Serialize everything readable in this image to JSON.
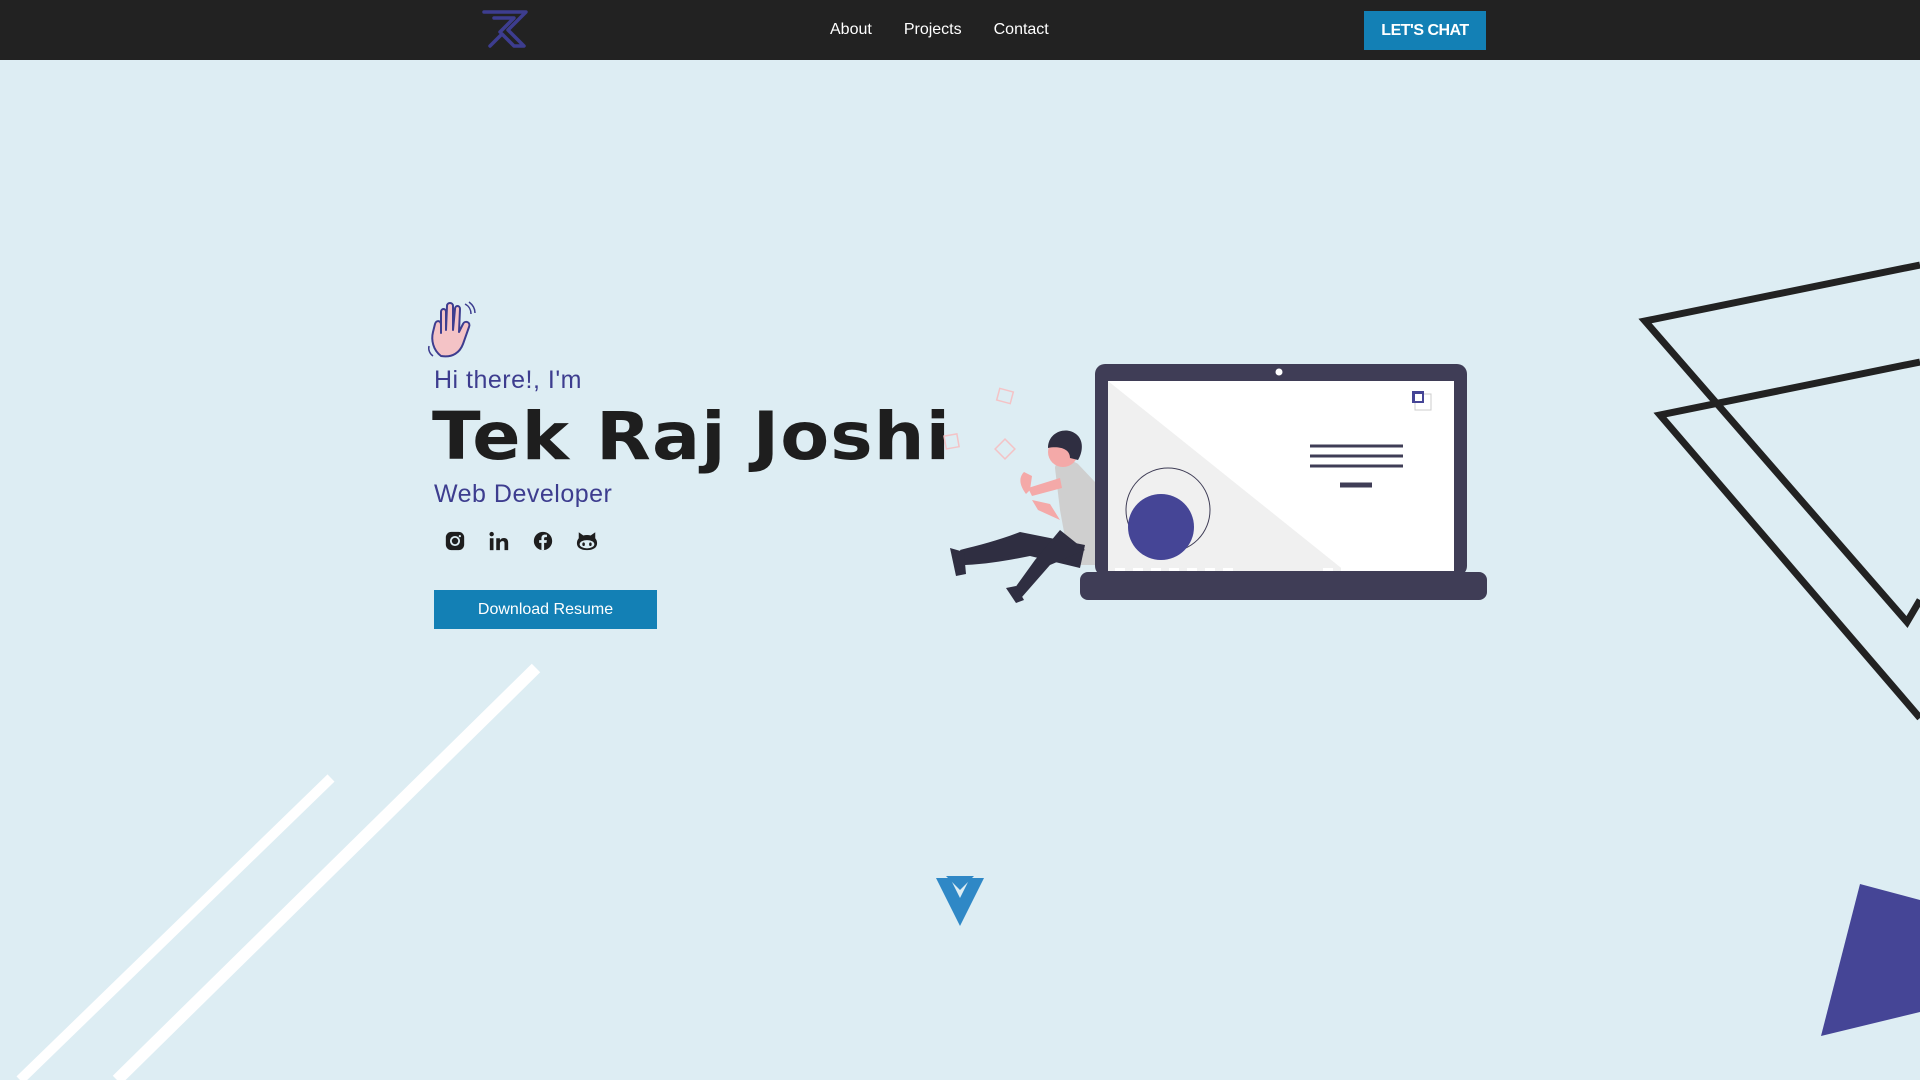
{
  "nav": {
    "logo_icon": "tr-monogram-logo",
    "links": [
      {
        "label": "About"
      },
      {
        "label": "Projects"
      },
      {
        "label": "Contact"
      }
    ],
    "cta_label": "LET'S CHAT"
  },
  "hero": {
    "wave_icon": "waving-hand-icon",
    "greeting": "Hi there!, I'm",
    "name": "Tek Raj Joshi",
    "role": "Web Developer",
    "socials": [
      {
        "icon": "instagram-icon"
      },
      {
        "icon": "linkedin-icon"
      },
      {
        "icon": "facebook-icon"
      },
      {
        "icon": "github-icon"
      }
    ],
    "resume_label": "Download Resume",
    "illustration": "developer-with-laptop-illustration",
    "scroll_icon": "chevron-down-icon"
  },
  "colors": {
    "background": "#ddedf3",
    "navbar": "#222222",
    "accent": "#1380b5",
    "purple": "#3d3d8f",
    "triangle": "#454596"
  }
}
